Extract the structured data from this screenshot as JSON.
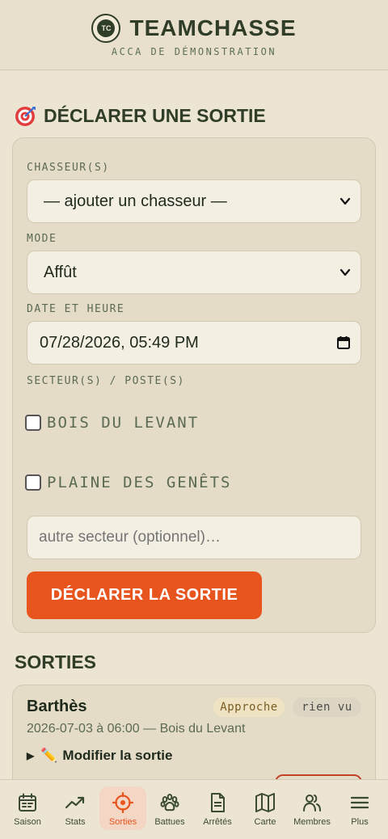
{
  "header": {
    "logo_text": "TC",
    "app_name": "TEAMCHASSE",
    "subtitle": "ACCA DE DÉMONSTRATION"
  },
  "declare": {
    "title": "DÉCLARER UNE SORTIE",
    "hunters_label": "CHASSEUR(S)",
    "hunters_value": "— ajouter un chasseur —",
    "mode_label": "MODE",
    "mode_value": "Affût",
    "date_label": "DATE ET HEURE",
    "date_value": "07/28/2026, 05:49 PM",
    "sectors_label": "SECTEUR(S) / POSTE(S)",
    "sectors": [
      "BOIS DU LEVANT",
      "PLAINE DES GENÊTS"
    ],
    "other_sector_placeholder": "autre secteur (optionnel)…",
    "submit_label": "DÉCLARER LA SORTIE"
  },
  "outings": {
    "title": "SORTIES",
    "items": [
      {
        "name": "Barthès",
        "mode": "Approche",
        "result": "rien vu",
        "meta": "2026-07-03 à 06:00 — Bois du Levant",
        "edit_label": "Modifier la sortie"
      }
    ]
  },
  "nav": {
    "items": [
      {
        "label": "Saison",
        "icon": "calendar-icon"
      },
      {
        "label": "Stats",
        "icon": "trend-up-icon"
      },
      {
        "label": "Sorties",
        "icon": "crosshair-icon",
        "active": true
      },
      {
        "label": "Battues",
        "icon": "paw-icon"
      },
      {
        "label": "Arrêtés",
        "icon": "document-icon"
      },
      {
        "label": "Carte",
        "icon": "map-icon"
      },
      {
        "label": "Membres",
        "icon": "users-icon"
      },
      {
        "label": "Plus",
        "icon": "menu-icon"
      }
    ]
  },
  "colors": {
    "accent": "#e8541e",
    "primary_text": "#2f3d29",
    "background": "#ede5d3"
  }
}
